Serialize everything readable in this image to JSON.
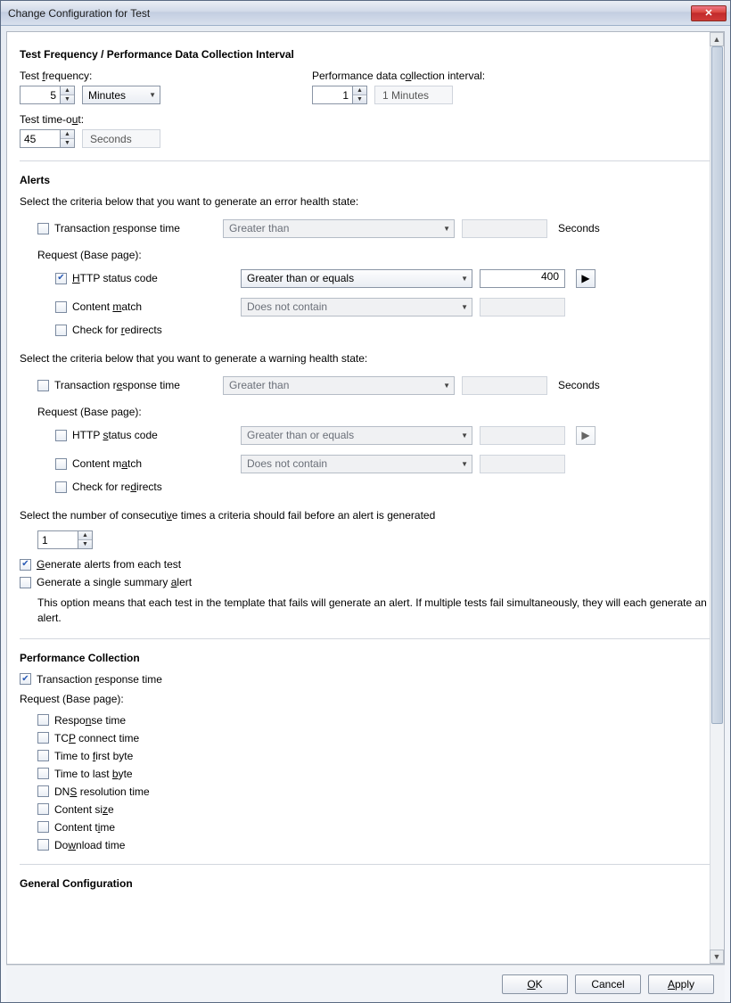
{
  "window": {
    "title": "Change Configuration for Test"
  },
  "section1": {
    "title": "Test Frequency / Performance Data Collection Interval",
    "freq_label": "Test frequency:",
    "freq_value": "5",
    "freq_unit": "Minutes",
    "interval_label": "Performance data collection interval:",
    "interval_value": "1",
    "interval_text": "1 Minutes",
    "timeout_label": "Test time-out:",
    "timeout_value": "45",
    "timeout_unit": "Seconds"
  },
  "alerts": {
    "title": "Alerts",
    "error_desc": "Select the criteria below that you want to generate an error health state:",
    "warn_desc": "Select the criteria below that you want to generate a warning health state:",
    "trt_label": "Transaction response time",
    "trt_op": "Greater than",
    "seconds": "Seconds",
    "request_label": "Request (Base page):",
    "http_label": "HTTP status code",
    "http_op": "Greater than or equals",
    "http_val": "400",
    "content_label": "Content match",
    "content_op": "Does not contain",
    "redirect_label": "Check for redirects",
    "consec_desc": "Select the number of consecutive times a criteria should fail before an alert is generated",
    "consec_value": "1",
    "gen_each": "Generate alerts from each test",
    "gen_single": "Generate a single summary alert",
    "note": "This option means that each test in the template that fails will generate an alert. If multiple tests fail simultaneously, they will each generate an alert."
  },
  "perf": {
    "title": "Performance Collection",
    "trt": "Transaction response time",
    "req_label": "Request (Base page):",
    "items": {
      "response": "Response time",
      "tcp": "TCP connect time",
      "ttfb": "Time to first byte",
      "ttlb": "Time to last byte",
      "dns": "DNS resolution time",
      "csize": "Content size",
      "ctime": "Content time",
      "dl": "Download time"
    }
  },
  "general": {
    "title": "General Configuration"
  },
  "footer": {
    "ok": "OK",
    "cancel": "Cancel",
    "apply": "Apply"
  }
}
